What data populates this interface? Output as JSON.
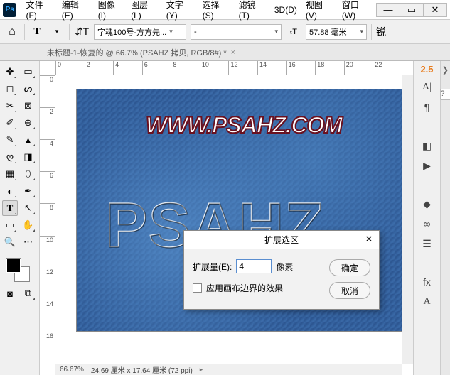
{
  "app": {
    "logo": "Ps"
  },
  "menu": {
    "file": "文件(F)",
    "edit": "编辑(E)",
    "image": "图像(I)",
    "layer": "图层(L)",
    "type": "文字(Y)",
    "select": "选择(S)",
    "filter": "滤镜(T)",
    "threeD": "3D(D)",
    "view": "视图(V)",
    "window": "窗口(W)"
  },
  "options": {
    "font_family": "字魂100号-方方先...",
    "font_style": "-",
    "size": "57.88 毫米",
    "right_glyph": "锐"
  },
  "document": {
    "tab_title": "未标题-1-恢复的 @ 66.7% (PSAHZ 拷贝, RGB/8#) *"
  },
  "ruler_h": [
    "0",
    "2",
    "4",
    "6",
    "8",
    "10",
    "12",
    "14",
    "16",
    "18",
    "20",
    "22"
  ],
  "ruler_v": [
    "0",
    "2",
    "4",
    "6",
    "8",
    "10",
    "12",
    "14",
    "16"
  ],
  "canvas": {
    "watermark": "WWW.PSAHZ.COM",
    "selection_text": "PSAHZ"
  },
  "rail": {
    "value": "2.5"
  },
  "dialog": {
    "title": "扩展选区",
    "expand_label": "扩展量(E):",
    "expand_value": "4",
    "unit": "像素",
    "apply_effect": "应用画布边界的效果",
    "ok": "确定",
    "cancel": "取消"
  },
  "status": {
    "zoom": "66.67%",
    "doc_info": "24.69 厘米 x 17.64 厘米 (72 ppi)"
  }
}
